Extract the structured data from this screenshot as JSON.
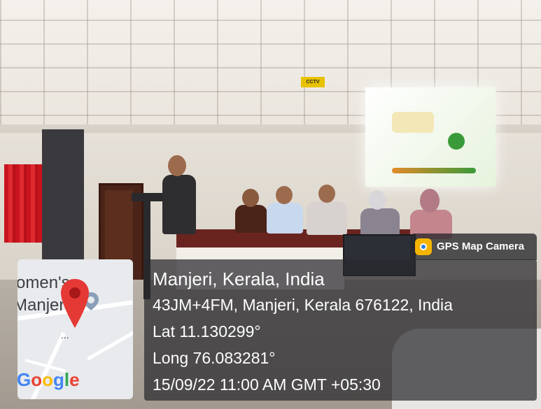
{
  "scene": {
    "cctv_sign": "CCTV"
  },
  "map": {
    "label_1": "omen's",
    "label_2": "Manjeri",
    "dots": "...",
    "google_logo": "Google"
  },
  "badge": {
    "icon": "gps-camera-icon",
    "label": "GPS Map Camera"
  },
  "location": {
    "place": "Manjeri, Kerala, India",
    "address": "43JM+4FM, Manjeri, Kerala 676122, India",
    "latitude": "Lat 11.130299°",
    "longitude": "Long 76.083281°",
    "timestamp": "15/09/22 11:00 AM GMT +05:30"
  },
  "colors": {
    "pin": "#e53935",
    "google_blue": "#4285F4",
    "google_red": "#EA4335",
    "google_yellow": "#FBBC05",
    "google_green": "#34A853"
  }
}
